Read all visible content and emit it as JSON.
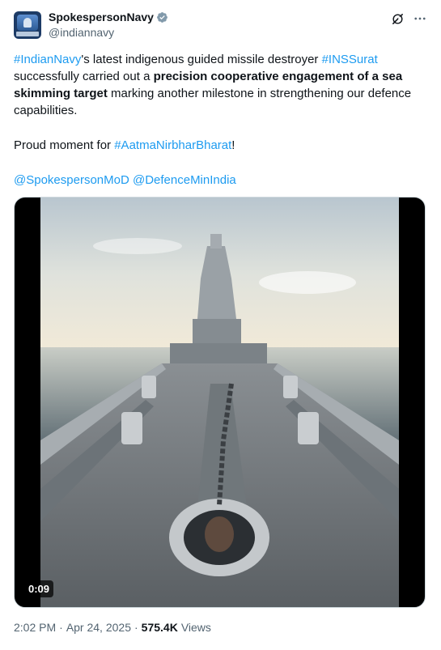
{
  "author": {
    "display_name": "SpokespersonNavy",
    "handle": "@indiannavy",
    "verified_icon": "verified-badge-icon",
    "accent": "#1d9bf0"
  },
  "actions": {
    "grok_icon": "grok-icon",
    "more_icon": "more-icon"
  },
  "tweet": {
    "line1_tag1": "#IndianNavy",
    "line1_mid": "'s latest indigenous guided missile destroyer ",
    "line1_tag2": "#INSSurat",
    "line2_pre": "successfully carried out a ",
    "line2_bold": "precision cooperative engagement of a sea skimming target",
    "line2_post": " marking another milestone in strengthening our defence capabilities.",
    "proud_pre": "Proud moment for  ",
    "proud_tag": "#AatmaNirbharBharat",
    "proud_post": "!",
    "mention1": "@SpokespersonMoD",
    "mention2": "@DefenceMinIndia"
  },
  "media": {
    "duration": "0:09"
  },
  "footer": {
    "time": "2:02 PM",
    "separator": "·",
    "date": "Apr 24, 2025",
    "views_count": "575.4K",
    "views_label": "Views"
  }
}
